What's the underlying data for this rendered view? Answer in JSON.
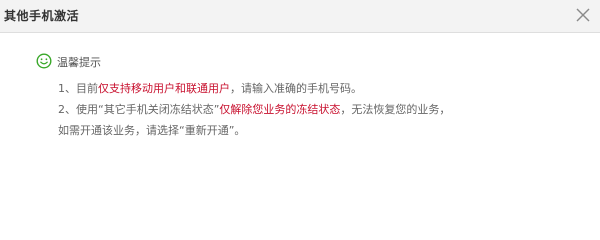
{
  "dialog": {
    "title": "其他手机激活",
    "close_icon": "close-icon"
  },
  "tip": {
    "icon": "smile-icon",
    "heading": "温馨提示",
    "line1": {
      "prefix": "1、目前",
      "highlight": "仅支持移动用户和联通用户",
      "suffix": "，请输入准确的手机号码。"
    },
    "line2": {
      "prefix": "2、使用“其它手机关闭冻结状态”",
      "highlight": "仅解除您业务的冻结状态",
      "suffix": "，无法恢复您的业务，"
    },
    "line3": {
      "text": "如需开通该业务，请选择“重新开通”。"
    }
  },
  "colors": {
    "highlight": "#c8102e",
    "icon_green": "#3aa82a",
    "titlebar_bg": "#f3f3f3"
  }
}
